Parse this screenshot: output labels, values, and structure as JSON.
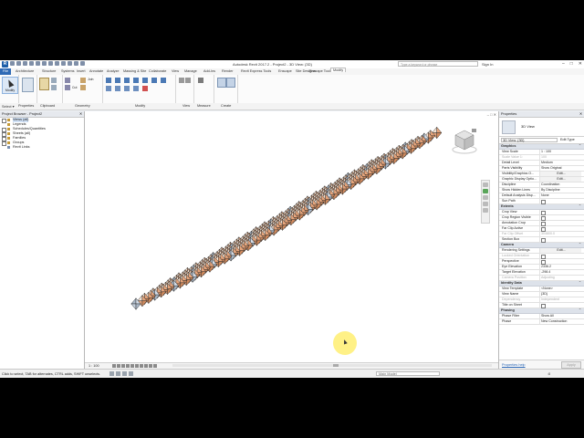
{
  "app": {
    "title": "Autodesk Revit 2017.2  -  Project2 - 3D View: {3D}",
    "logo": "R",
    "search_placeholder": "Type a keyword or phrase",
    "sign_in": "Sign In",
    "window_controls": [
      "–",
      "□",
      "✕"
    ]
  },
  "tabs": [
    "File",
    "Architecture",
    "Structure",
    "Systems",
    "Insert",
    "Annotate",
    "Analyze",
    "Massing & Site",
    "Collaborate",
    "View",
    "Manage",
    "Add-Ins",
    "Render",
    "Revit Express Tools",
    "Enscape",
    "Site Designer",
    "Enscape Tools",
    "Modify"
  ],
  "ribbon": {
    "modify_label": "Modify",
    "panels": [
      "Select ▾",
      "Properties",
      "Clipboard",
      "Geometry",
      "Modify",
      "View",
      "Measure",
      "Create"
    ],
    "geometry_items": [
      "Cut",
      "Join"
    ]
  },
  "option_bar": [
    "Select ▾",
    "Properties",
    "Clipboard",
    "Geometry",
    "Modify",
    "View",
    "Measure",
    "Create"
  ],
  "browser": {
    "title": "Project Browser - Project2",
    "close": "✕",
    "items": [
      "Views (all)",
      "Legends",
      "Schedules/Quantities",
      "Sheets (all)",
      "Families",
      "Groups",
      "Revit Links"
    ]
  },
  "viewport": {
    "window_controls": "– □ ✕",
    "scale": "1 : 100"
  },
  "properties": {
    "title": "Properties",
    "close": "✕",
    "type_name": "3D View",
    "instance": "3D View: {3D}",
    "edit_type": "Edit Type",
    "groups": [
      {
        "name": "Graphics",
        "rows": [
          {
            "k": "View Scale",
            "v": "1 : 100"
          },
          {
            "k": "Scale Value  1:",
            "v": "100"
          },
          {
            "k": "Detail Level",
            "v": "Medium"
          },
          {
            "k": "Parts Visibility",
            "v": "Show Original"
          },
          {
            "k": "Visibility/Graphics O...",
            "v": "Edit..."
          },
          {
            "k": "Graphic Display Optio...",
            "v": "Edit..."
          },
          {
            "k": "Discipline",
            "v": "Coordination"
          },
          {
            "k": "Show Hidden Lines",
            "v": "By Discipline"
          },
          {
            "k": "Default Analysis Disp...",
            "v": "None"
          },
          {
            "k": "Sun Path",
            "v": ""
          }
        ]
      },
      {
        "name": "Extents",
        "rows": [
          {
            "k": "Crop View",
            "v": ""
          },
          {
            "k": "Crop Region Visible",
            "v": ""
          },
          {
            "k": "Annotation Crop",
            "v": ""
          },
          {
            "k": "Far Clip Active",
            "v": ""
          },
          {
            "k": "Far Clip Offset",
            "v": "304800.0"
          },
          {
            "k": "Section Box",
            "v": ""
          }
        ]
      },
      {
        "name": "Camera",
        "rows": [
          {
            "k": "Rendering Settings",
            "v": "Edit..."
          },
          {
            "k": "Locked Orientation",
            "v": ""
          },
          {
            "k": "Perspective",
            "v": ""
          },
          {
            "k": "Eye Elevation",
            "v": "2336.2"
          },
          {
            "k": "Target Elevation",
            "v": "-298.4"
          },
          {
            "k": "Camera Position",
            "v": "Adjusting"
          }
        ]
      },
      {
        "name": "Identity Data",
        "rows": [
          {
            "k": "View Template",
            "v": "<None>"
          },
          {
            "k": "View Name",
            "v": "{3D}"
          },
          {
            "k": "Dependency",
            "v": "Independent"
          },
          {
            "k": "Title on Sheet",
            "v": ""
          }
        ]
      },
      {
        "name": "Phasing",
        "rows": [
          {
            "k": "Phase Filter",
            "v": "Show All"
          },
          {
            "k": "Phase",
            "v": "New Construction"
          }
        ]
      }
    ],
    "help": "Properties help",
    "apply": "Apply"
  },
  "status": {
    "message": "Click to select, TAB for alternates, CTRL adds, SHIFT unselects.",
    "model": "Main Model",
    "filter": ":0"
  },
  "colors": {
    "tile_orange": "#e6a57c",
    "tile_blue": "#aab8c8",
    "tile_light": "#f4e2d2",
    "accent": "#2f6ab5"
  }
}
